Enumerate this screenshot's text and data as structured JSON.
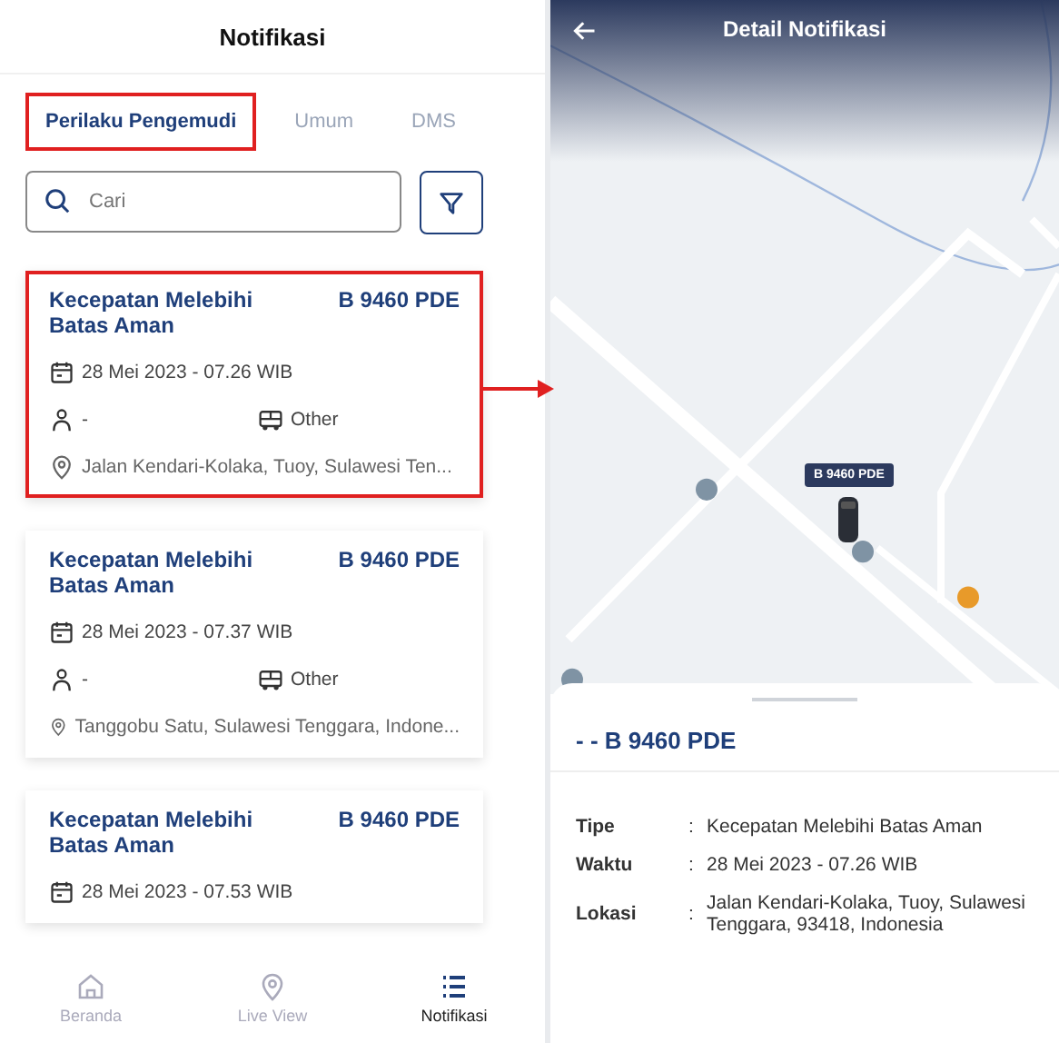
{
  "list_screen": {
    "title": "Notifikasi",
    "tabs": [
      {
        "label": "Perilaku Pengemudi",
        "selected": true,
        "highlighted": true
      },
      {
        "label": "Umum",
        "selected": false,
        "highlighted": false
      },
      {
        "label": "DMS",
        "selected": false,
        "highlighted": false
      }
    ],
    "search": {
      "placeholder": "Cari"
    },
    "cards": [
      {
        "title": "Kecepatan Melebihi Batas Aman",
        "plate": "B 9460 PDE",
        "time": "28 Mei 2023 - 07.26 WIB",
        "driver": "-",
        "vehicle": "Other",
        "location": "Jalan Kendari-Kolaka, Tuoy, Sulawesi Ten...",
        "highlighted": true
      },
      {
        "title": "Kecepatan Melebihi Batas Aman",
        "plate": "B 9460 PDE",
        "time": "28 Mei 2023 - 07.37 WIB",
        "driver": "-",
        "vehicle": "Other",
        "location": "Tanggobu Satu, Sulawesi Tenggara, Indone...",
        "highlighted": false
      },
      {
        "title": "Kecepatan Melebihi Batas Aman",
        "plate": "B 9460 PDE",
        "time": "28 Mei 2023 - 07.53 WIB",
        "highlighted": false
      }
    ],
    "bottom_nav": [
      {
        "label": "Beranda",
        "selected": false
      },
      {
        "label": "Live View",
        "selected": false
      },
      {
        "label": "Notifikasi",
        "selected": true
      }
    ]
  },
  "detail_screen": {
    "title": "Detail Notifikasi",
    "map": {
      "kind": "picture",
      "marker_label": "B 9460 PDE"
    },
    "sheet_title": "- - B 9460 PDE",
    "fields": [
      {
        "label": "Tipe",
        "separator": ":",
        "value": "Kecepatan Melebihi Batas Aman"
      },
      {
        "label": "Waktu",
        "separator": ":",
        "value": "28 Mei 2023 - 07.26 WIB"
      },
      {
        "label": "Lokasi",
        "separator": ":",
        "value": "Jalan Kendari-Kolaka, Tuoy, Sulawesi Tenggara, 93418, Indonesia"
      }
    ]
  }
}
